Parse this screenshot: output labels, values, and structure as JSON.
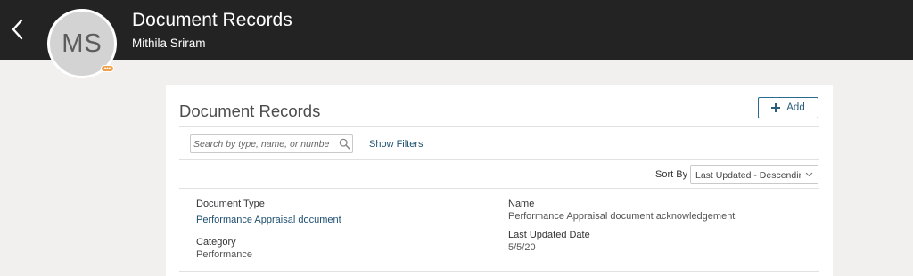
{
  "header": {
    "title": "Document Records",
    "person_name": "Mithila Sriram",
    "avatar_initials": "MS",
    "presence_text": "•••",
    "background": "#232323",
    "back_icon": "chevron-left-icon"
  },
  "card": {
    "title": "Document Records",
    "add_label": "Add",
    "add_icon": "plus-icon"
  },
  "search": {
    "placeholder": "Search by type, name, or number",
    "value": "",
    "icon": "search-icon"
  },
  "filters": {
    "label": "Show Filters"
  },
  "sort": {
    "label": "Sort By",
    "selected": "Last Updated - Descending",
    "icon": "chevron-down-icon"
  },
  "record": {
    "document_type_label": "Document Type",
    "document_type_value": "Performance Appraisal document",
    "category_label": "Category",
    "category_value": "Performance",
    "name_label": "Name",
    "name_value": "Performance Appraisal document acknowledgement",
    "updated_label": "Last Updated Date",
    "updated_value": "5/5/20"
  },
  "colors": {
    "accent": "#1d4f6f",
    "presence": "#f0a04b",
    "page_bg": "#f1f0ef"
  }
}
